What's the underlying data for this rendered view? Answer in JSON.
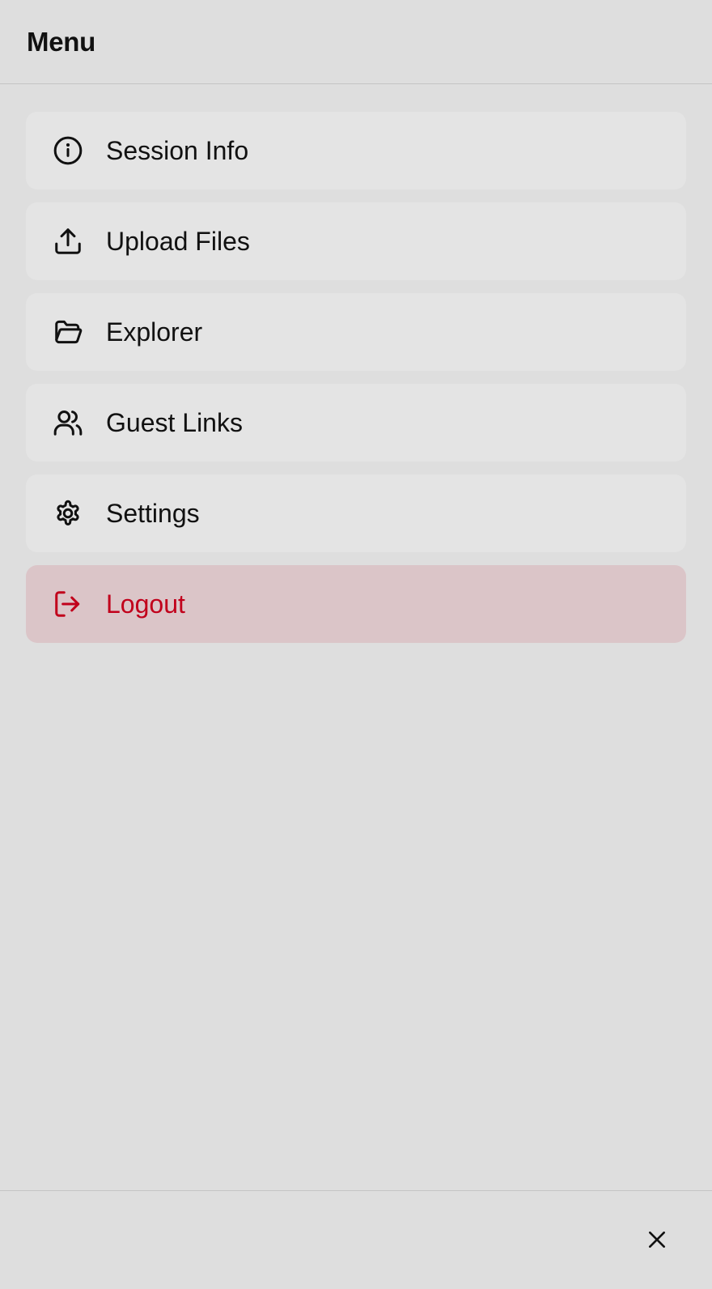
{
  "header": {
    "title": "Menu"
  },
  "menu": {
    "items": [
      {
        "label": "Session Info",
        "icon": "info-circle-icon"
      },
      {
        "label": "Upload Files",
        "icon": "upload-icon"
      },
      {
        "label": "Explorer",
        "icon": "folder-open-icon"
      },
      {
        "label": "Guest Links",
        "icon": "users-icon"
      },
      {
        "label": "Settings",
        "icon": "gear-icon"
      },
      {
        "label": "Logout",
        "icon": "logout-icon"
      }
    ]
  },
  "footer": {
    "close_icon": "close-icon"
  },
  "colors": {
    "background": "#dedede",
    "item_background": "#e4e4e4",
    "danger_background": "#dbc5c8",
    "danger_text": "#c1001b",
    "text": "#111111",
    "divider": "#c4c4c4"
  }
}
